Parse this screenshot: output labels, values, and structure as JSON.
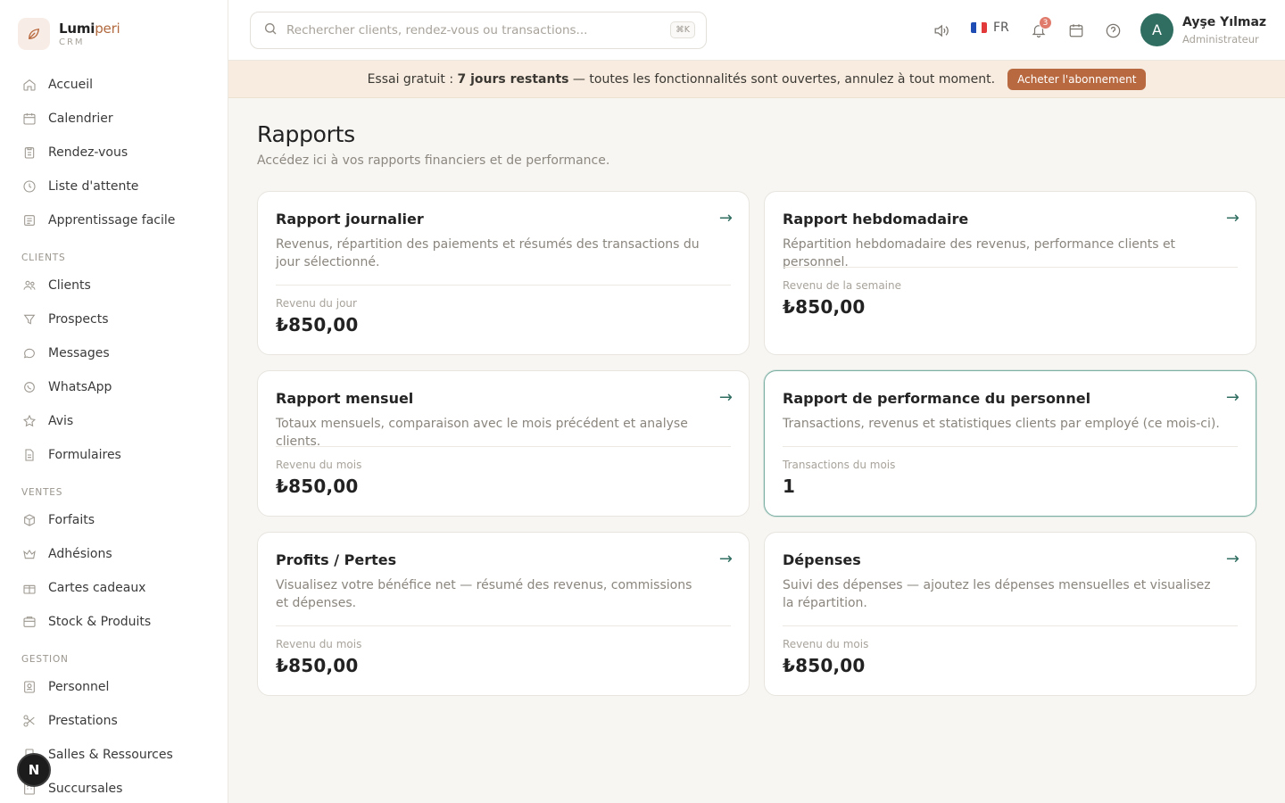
{
  "brand": {
    "name_a": "Lumi",
    "name_b": "peri",
    "sub": "CRM"
  },
  "sidebar": {
    "items_top": [
      {
        "label": "Accueil",
        "icon": "home-icon"
      },
      {
        "label": "Calendrier",
        "icon": "calendar-icon"
      },
      {
        "label": "Rendez-vous",
        "icon": "clipboard-icon"
      },
      {
        "label": "Liste d'attente",
        "icon": "clock-icon"
      },
      {
        "label": "Apprentissage facile",
        "icon": "book-icon"
      }
    ],
    "sections": [
      {
        "title": "CLIENTS",
        "items": [
          {
            "label": "Clients",
            "icon": "users-icon"
          },
          {
            "label": "Prospects",
            "icon": "filter-icon"
          },
          {
            "label": "Messages",
            "icon": "chat-icon"
          },
          {
            "label": "WhatsApp",
            "icon": "whatsapp-icon"
          },
          {
            "label": "Avis",
            "icon": "star-icon"
          },
          {
            "label": "Formulaires",
            "icon": "document-icon"
          }
        ]
      },
      {
        "title": "VENTES",
        "items": [
          {
            "label": "Forfaits",
            "icon": "box-icon"
          },
          {
            "label": "Adhésions",
            "icon": "crown-icon"
          },
          {
            "label": "Cartes cadeaux",
            "icon": "gift-icon"
          },
          {
            "label": "Stock & Produits",
            "icon": "inventory-icon"
          }
        ]
      },
      {
        "title": "GESTION",
        "items": [
          {
            "label": "Personnel",
            "icon": "badge-icon"
          },
          {
            "label": "Prestations",
            "icon": "scissors-icon"
          },
          {
            "label": "Salles & Ressources",
            "icon": "door-icon"
          },
          {
            "label": "Succursales",
            "icon": "building-icon"
          }
        ]
      }
    ],
    "floating_badge": "N"
  },
  "topbar": {
    "search_placeholder": "Rechercher clients, rendez-vous ou transactions...",
    "search_shortcut": "⌘K",
    "language": "FR",
    "notifications_count": "3",
    "user": {
      "initial": "A",
      "name": "Ayşe Yılmaz",
      "role": "Administrateur"
    }
  },
  "banner": {
    "lead": "Essai gratuit : ",
    "days": "7 jours restants",
    "rest": " — toutes les fonctionnalités sont ouvertes, annulez à tout moment.",
    "button": "Acheter l'abonnement"
  },
  "page": {
    "title": "Rapports",
    "subtitle": "Accédez ici à vos rapports financiers et de performance."
  },
  "cards": [
    {
      "title": "Rapport journalier",
      "desc": "Revenus, répartition des paiements et résumés des transactions du jour sélectionné.",
      "label": "Revenu du jour",
      "value": "₺850,00"
    },
    {
      "title": "Rapport hebdomadaire",
      "desc": "Répartition hebdomadaire des revenus, performance clients et personnel.",
      "label": "Revenu de la semaine",
      "value": "₺850,00"
    },
    {
      "title": "Rapport mensuel",
      "desc": "Totaux mensuels, comparaison avec le mois précédent et analyse clients.",
      "label": "Revenu du mois",
      "value": "₺850,00"
    },
    {
      "title": "Rapport de performance du personnel",
      "desc": "Transactions, revenus et statistiques clients par employé (ce mois-ci).",
      "label": "Transactions du mois",
      "value": "1"
    },
    {
      "title": "Profits / Pertes",
      "desc": "Visualisez votre bénéfice net — résumé des revenus, commissions et dépenses.",
      "label": "Revenu du mois",
      "value": "₺850,00"
    },
    {
      "title": "Dépenses",
      "desc": "Suivi des dépenses — ajoutez les dépenses mensuelles et visualisez la répartition.",
      "label": "Revenu du mois",
      "value": "₺850,00"
    }
  ],
  "colors": {
    "accent": "#b8693f",
    "primary": "#2f6e61",
    "banner_bg": "#f7ecdf"
  }
}
